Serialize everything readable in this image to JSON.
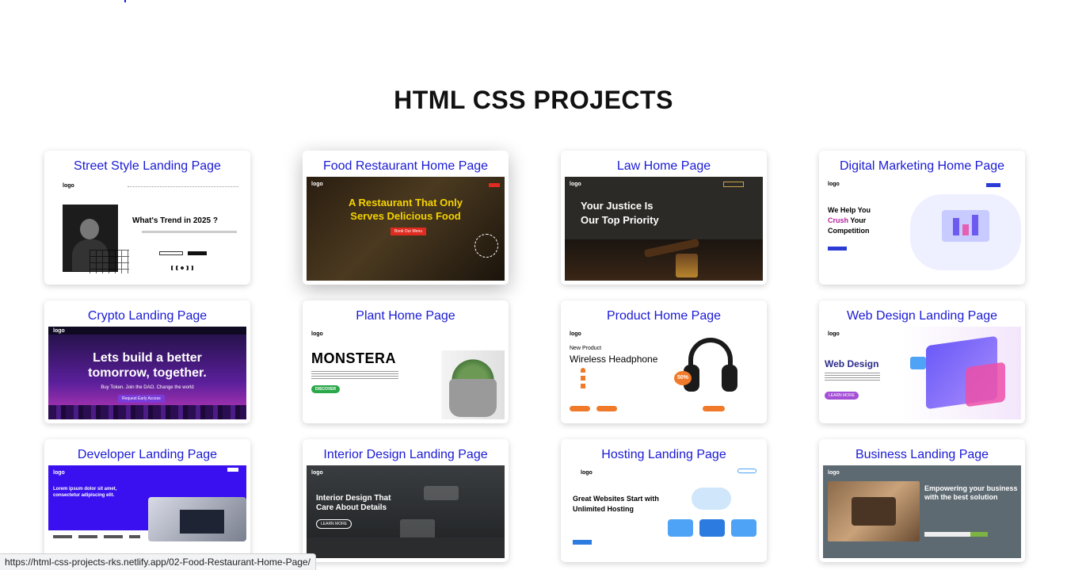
{
  "page": {
    "title": "HTML CSS PROJECTS"
  },
  "status_bar": {
    "url": "https://html-css-projects-rks.netlify.app/02-Food-Restaurant-Home-Page/"
  },
  "projects": [
    {
      "title": "Street Style Landing Page",
      "thumb": {
        "logo": "logo",
        "headline": "What's Trend in 2025 ?"
      }
    },
    {
      "title": "Food Restaurant Home Page",
      "thumb": {
        "logo": "logo",
        "headline": "A Restaurant That Only Serves Delicious Food",
        "button": "Book Our Menu"
      }
    },
    {
      "title": "Law Home Page",
      "thumb": {
        "logo": "logo",
        "headline": "Your Justice Is Our Top Priority"
      }
    },
    {
      "title": "Digital Marketing Home Page",
      "thumb": {
        "logo": "logo",
        "headline_1": "We Help You",
        "headline_accent": "Crush",
        "headline_2": "Your Competition"
      }
    },
    {
      "title": "Crypto Landing Page",
      "thumb": {
        "logo": "logo",
        "headline": "Lets build a better tomorrow, together.",
        "sub": "Buy Token. Join the DAO. Change the world",
        "button": "Request Early Access"
      }
    },
    {
      "title": "Plant Home Page",
      "thumb": {
        "logo": "logo",
        "headline": "MONSTERA",
        "button": "DISCOVER"
      }
    },
    {
      "title": "Product Home Page",
      "thumb": {
        "logo": "logo",
        "eyebrow": "New Product",
        "headline": "Wireless Headphone",
        "badge": "50%"
      }
    },
    {
      "title": "Web Design Landing Page",
      "thumb": {
        "logo": "logo",
        "headline": "Web Design",
        "button": "LEARN MORE"
      }
    },
    {
      "title": "Developer Landing Page",
      "thumb": {
        "logo": "logo",
        "headline": "Lorem ipsum dolor sit amet, consectetur adipiscing elit."
      }
    },
    {
      "title": "Interior Design Landing Page",
      "thumb": {
        "logo": "logo",
        "headline": "Interior Design That Care About Details",
        "button": "LEARN MORE"
      }
    },
    {
      "title": "Hosting Landing Page",
      "thumb": {
        "logo": "logo",
        "headline": "Great Websites Start with Unlimited Hosting"
      }
    },
    {
      "title": "Business Landing Page",
      "thumb": {
        "logo": "logo",
        "headline": "Empowering your business with the best solution"
      }
    }
  ],
  "colors": {
    "link": "#1a1ad6",
    "title": "#111111",
    "food_accent": "#f5d300",
    "crypto_bg": "#3b1a6e",
    "dev_bg": "#3a10f0"
  }
}
